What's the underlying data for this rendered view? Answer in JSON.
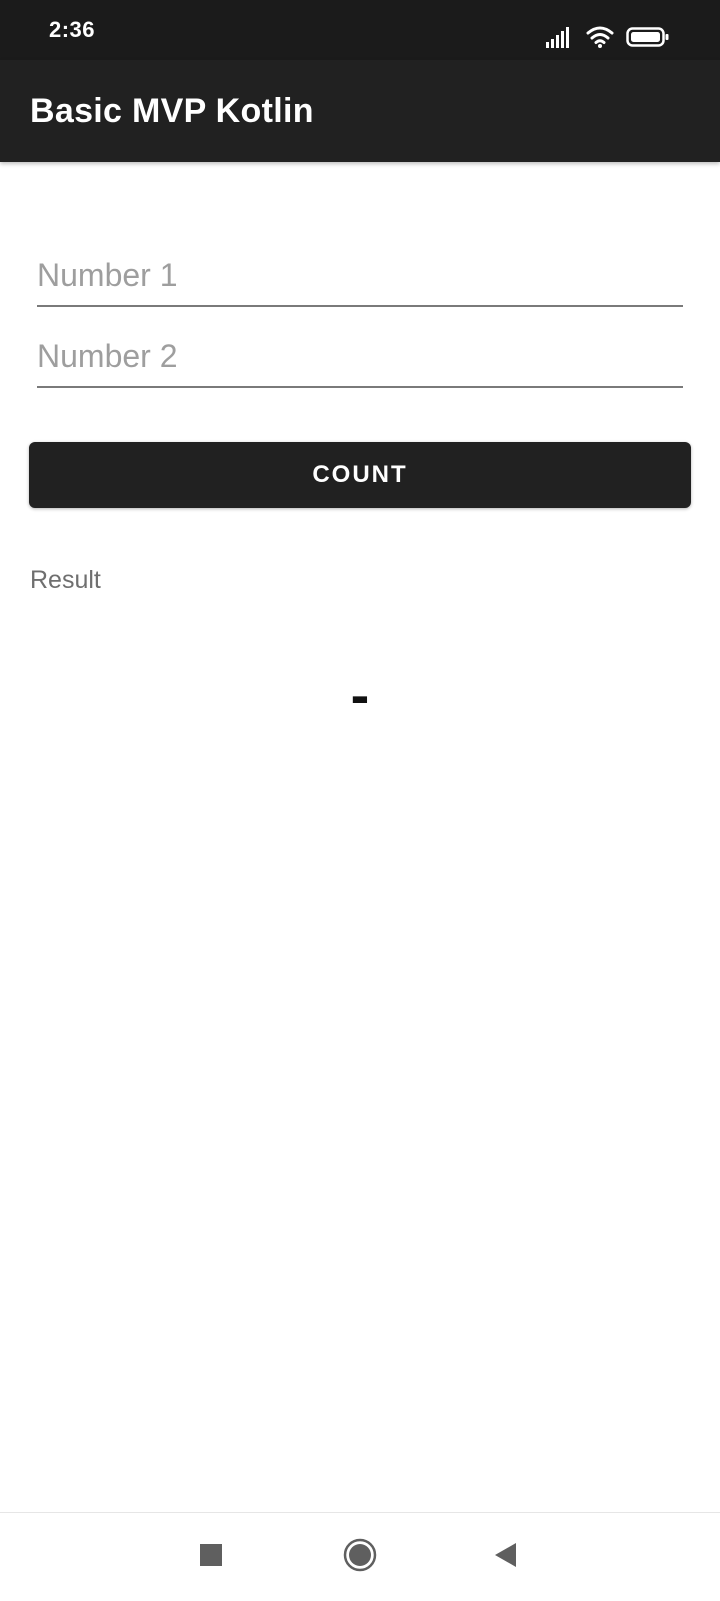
{
  "status_bar": {
    "time": "2:36",
    "icons": [
      "signal-icon",
      "wifi-icon",
      "battery-icon"
    ]
  },
  "app_bar": {
    "title": "Basic MVP Kotlin"
  },
  "form": {
    "number1": {
      "value": "",
      "placeholder": "Number 1"
    },
    "number2": {
      "value": "",
      "placeholder": "Number 2"
    },
    "count_label": "COUNT"
  },
  "result": {
    "label": "Result",
    "value": "-"
  },
  "nav_bar": {
    "buttons": [
      "recents-icon",
      "home-icon",
      "back-icon"
    ]
  },
  "colors": {
    "status_bar_bg": "#1b1b1b",
    "app_bar_bg": "#212121",
    "button_bg": "#212121",
    "text_on_dark": "#ffffff",
    "placeholder": "#9e9e9e",
    "underline": "#7a7a7a"
  }
}
